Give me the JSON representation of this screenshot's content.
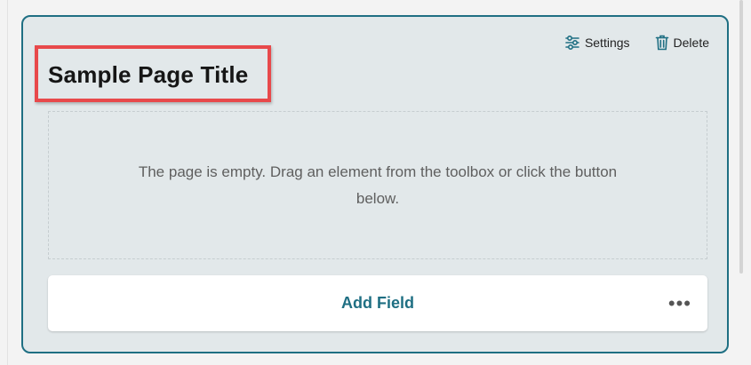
{
  "page": {
    "title": "Sample Page Title",
    "empty_message": "The page is empty. Drag an element from the toolbox or click the button below."
  },
  "actions": {
    "settings_label": "Settings",
    "delete_label": "Delete"
  },
  "add_bar": {
    "add_field_label": "Add Field",
    "more_label": "•••"
  },
  "colors": {
    "accent": "#1f6f83",
    "highlight": "#e8494b"
  }
}
